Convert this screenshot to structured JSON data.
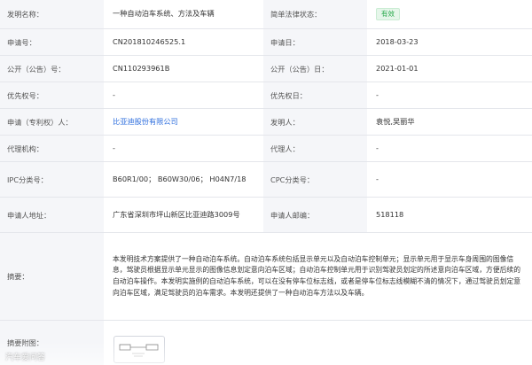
{
  "fields": {
    "invention_name": {
      "label": "发明名称：",
      "value": "一种自动泊车系统、方法及车辆"
    },
    "legal_status": {
      "label": "简单法律状态：",
      "value": "有效"
    },
    "application_no": {
      "label": "申请号：",
      "value": "CN201810246525.1"
    },
    "application_date": {
      "label": "申请日：",
      "value": "2018-03-23"
    },
    "publication_no": {
      "label": "公开（公告）号：",
      "value": "CN110293961B"
    },
    "publication_date": {
      "label": "公开（公告）日：",
      "value": "2021-01-01"
    },
    "priority_no": {
      "label": "优先权号：",
      "value": "-"
    },
    "priority_date": {
      "label": "优先权日：",
      "value": "-"
    },
    "applicant": {
      "label": "申请（专利权）人：",
      "value": "比亚迪股份有限公司"
    },
    "inventor": {
      "label": "发明人：",
      "value": "袁悦,吴丽华"
    },
    "agency": {
      "label": "代理机构：",
      "value": "-"
    },
    "agent": {
      "label": "代理人：",
      "value": "-"
    },
    "ipc": {
      "label": "IPC分类号：",
      "value": "B60R1/00； B60W30/06； H04N7/18"
    },
    "cpc": {
      "label": "CPC分类号：",
      "value": "-"
    },
    "applicant_address": {
      "label": "申请人地址：",
      "value": "广东省深圳市坪山新区比亚迪路3009号"
    },
    "applicant_zip": {
      "label": "申请人邮编：",
      "value": "518118"
    },
    "abstract": {
      "label": "摘要：",
      "value": "本发明技术方案提供了一种自动泊车系统。自动泊车系统包括显示单元以及自动泊车控制单元；显示单元用于显示车身周围的图像信息，驾驶员根据显示单元显示的图像信息划定意向泊车区域；自动泊车控制单元用于识别驾驶员划定的所述意向泊车区域，方便后续的自动泊车操作。本发明实施例的自动泊车系统，可以在没有停车位标志线，或者是停车位标志线模糊不清的情况下，通过驾驶员划定意向泊车区域，满足驾驶员的泊车需求。本发明还提供了一种自动泊车方法以及车辆。"
    },
    "abstract_figure": {
      "label": "摘要附图："
    }
  },
  "watermark": "汽车爱问答",
  "colors": {
    "label_bg": "#f5f6f9",
    "link": "#2f6fde",
    "status_green": "#27a84a"
  }
}
